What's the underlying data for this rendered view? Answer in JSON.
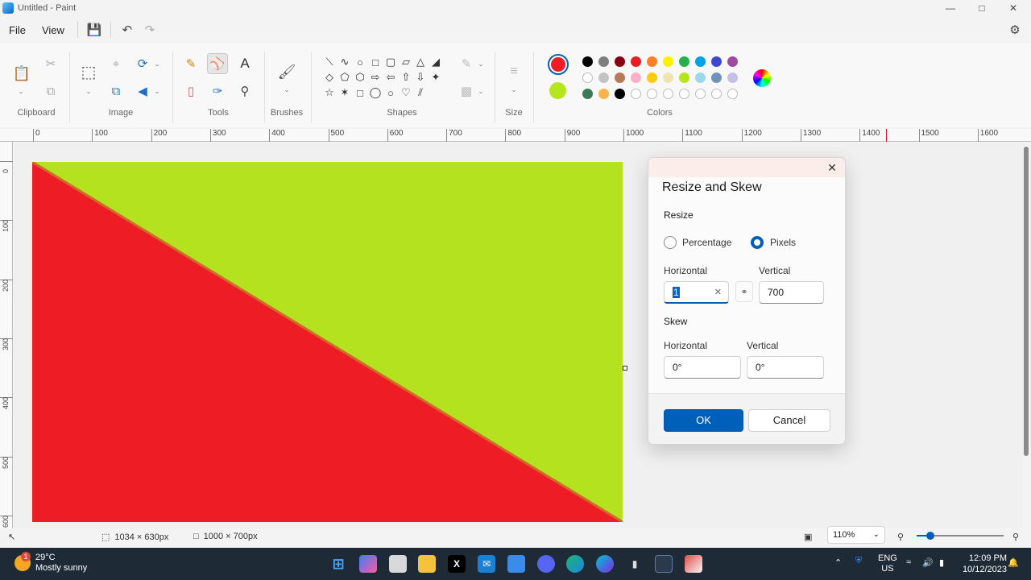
{
  "window": {
    "title": "Untitled - Paint"
  },
  "menu": {
    "file": "File",
    "view": "View"
  },
  "ribbon": {
    "groups": [
      "Clipboard",
      "Image",
      "Tools",
      "Brushes",
      "Shapes",
      "Size",
      "Colors"
    ],
    "tools_text_label": "A"
  },
  "colors": {
    "primary": "#ee1c25",
    "secondary": "#b5e61d",
    "palette_row1": [
      "#000000",
      "#7f7f7f",
      "#880015",
      "#ed1c24",
      "#ff7f27",
      "#fff200",
      "#22b14c",
      "#00a2e8",
      "#3f48cc",
      "#a349a4"
    ],
    "palette_row2": [
      "#ffffff",
      "#c3c3c3",
      "#b97a57",
      "#ffaec9",
      "#ffc90e",
      "#efe4b0",
      "#b5e61d",
      "#99d9ea",
      "#7092be",
      "#c8bfe7"
    ],
    "palette_row3": [
      "#3b7a57",
      "#ffb347",
      "#000000",
      "",
      "",
      "",
      "",
      "",
      "",
      ""
    ]
  },
  "ruler": {
    "h_ticks": [
      "0",
      "100",
      "200",
      "300",
      "400",
      "500",
      "600",
      "700",
      "800",
      "900",
      "1000",
      "1100",
      "1200",
      "1300",
      "1400",
      "1500",
      "1600"
    ],
    "v_ticks": [
      "0",
      "100",
      "200",
      "300",
      "400",
      "500",
      "600"
    ]
  },
  "dialog": {
    "title": "Resize and Skew",
    "resize_label": "Resize",
    "percentage_label": "Percentage",
    "pixels_label": "Pixels",
    "horizontal_label": "Horizontal",
    "vertical_label": "Vertical",
    "horizontal_value": "1",
    "vertical_value": "700",
    "skew_label": "Skew",
    "skew_horizontal_label": "Horizontal",
    "skew_vertical_label": "Vertical",
    "skew_horizontal_value": "0°",
    "skew_vertical_value": "0°",
    "ok_label": "OK",
    "cancel_label": "Cancel"
  },
  "status": {
    "selection_size": "1034 × 630px",
    "canvas_size": "1000 × 700px",
    "zoom": "110%"
  },
  "taskbar": {
    "temperature": "29°C",
    "weather": "Mostly sunny",
    "weather_badge": "1",
    "lang_top": "ENG",
    "lang_bottom": "US",
    "time": "12:09 PM",
    "date": "10/12/2023"
  }
}
